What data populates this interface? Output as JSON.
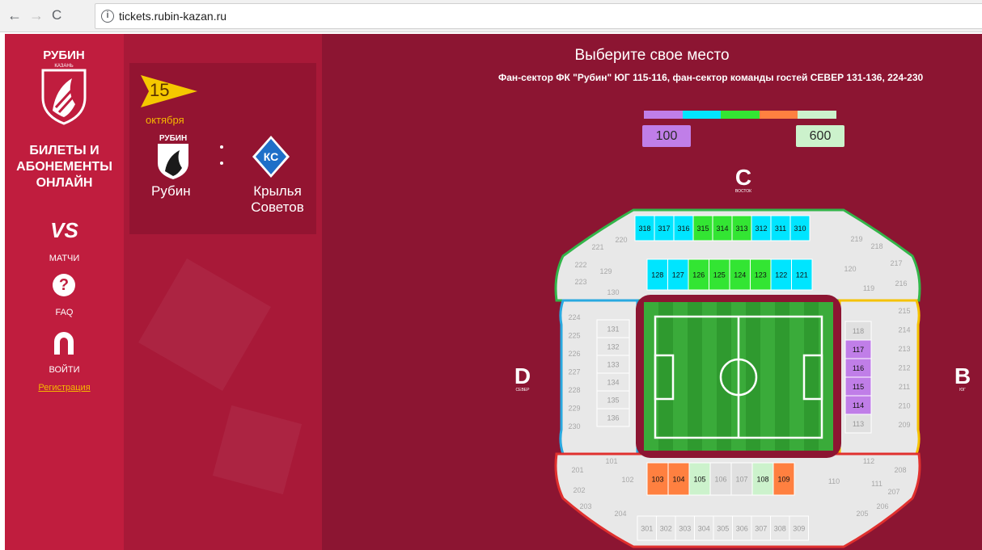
{
  "browser": {
    "url": "tickets.rubin-kazan.ru",
    "back_icon": "←",
    "forward_icon": "→",
    "reload_icon": "C",
    "info_icon": "i"
  },
  "sidebar": {
    "logo_text": "РУБИН",
    "logo_sub": "КАЗАНЬ",
    "title": "БИЛЕТЫ И АБОНЕМЕНТЫ ОНЛАЙН",
    "vs": "VS",
    "matches_label": "МАТЧИ",
    "faq_icon": "?",
    "faq_label": "FAQ",
    "login_label": "ВОЙТИ",
    "register_label": "Регистрация"
  },
  "match": {
    "day": "15",
    "month": "октября",
    "home_logo_text": "РУБИН",
    "home_team": "Рубин",
    "away_team_line1": "Крылья",
    "away_team_line2": "Советов",
    "away_logo_text": "КС"
  },
  "main": {
    "title": "Выберите свое место",
    "subtitle": "Фан-сектор ФК \"Рубин\" ЮГ 115-116, фан-сектор команды гостей СЕВЕР 131-136, 224-230",
    "price_min": "100",
    "price_max": "600",
    "legend_colors": [
      "#c07ee8",
      "#00e5ff",
      "#33e533",
      "#ff8040",
      "#ccf2cc"
    ]
  },
  "directions": {
    "north_letter": "D",
    "north_label": "СЕВЕР",
    "south_letter": "B",
    "south_label": "ЮГ",
    "east_letter": "C",
    "east_label": "ВОСТОК"
  },
  "sectors": {
    "top_upper": [
      {
        "n": "318",
        "c": "#00e5ff"
      },
      {
        "n": "317",
        "c": "#00e5ff"
      },
      {
        "n": "316",
        "c": "#00e5ff"
      },
      {
        "n": "315",
        "c": "#33e533"
      },
      {
        "n": "314",
        "c": "#33e533"
      },
      {
        "n": "313",
        "c": "#33e533"
      },
      {
        "n": "312",
        "c": "#00e5ff"
      },
      {
        "n": "311",
        "c": "#00e5ff"
      },
      {
        "n": "310",
        "c": "#00e5ff"
      }
    ],
    "top_lower": [
      {
        "n": "128",
        "c": "#00e5ff"
      },
      {
        "n": "127",
        "c": "#00e5ff"
      },
      {
        "n": "126",
        "c": "#33e533"
      },
      {
        "n": "125",
        "c": "#33e533"
      },
      {
        "n": "124",
        "c": "#33e533"
      },
      {
        "n": "123",
        "c": "#33e533"
      },
      {
        "n": "122",
        "c": "#00e5ff"
      },
      {
        "n": "121",
        "c": "#00e5ff"
      }
    ],
    "bottom_lower": [
      {
        "n": "103",
        "c": "#ff8040"
      },
      {
        "n": "104",
        "c": "#ff8040"
      },
      {
        "n": "105",
        "c": "#ccf2cc"
      },
      {
        "n": "106",
        "c": "#e0e0e0"
      },
      {
        "n": "107",
        "c": "#e0e0e0"
      },
      {
        "n": "108",
        "c": "#ccf2cc"
      },
      {
        "n": "109",
        "c": "#ff8040"
      }
    ],
    "bottom_upper": [
      "301",
      "302",
      "303",
      "304",
      "305",
      "306",
      "307",
      "308",
      "309"
    ],
    "left_inner": [
      "131",
      "132",
      "133",
      "134",
      "135",
      "136"
    ],
    "left_outer": [
      "224",
      "225",
      "226",
      "227",
      "228",
      "229",
      "230"
    ],
    "right_inner": [
      {
        "n": "118",
        "c": "#e0e0e0"
      },
      {
        "n": "117",
        "c": "#c07ee8"
      },
      {
        "n": "116",
        "c": "#c07ee8"
      },
      {
        "n": "115",
        "c": "#c07ee8"
      },
      {
        "n": "114",
        "c": "#c07ee8"
      },
      {
        "n": "113",
        "c": "#e0e0e0"
      }
    ],
    "right_outer": [
      "215",
      "214",
      "213",
      "212",
      "211",
      "210",
      "209"
    ],
    "corners": {
      "tl": [
        "221",
        "220",
        "222",
        "129",
        "223",
        "130"
      ],
      "tr": [
        "219",
        "218",
        "120",
        "217",
        "119",
        "216"
      ],
      "bl": [
        "101",
        "201",
        "102",
        "202",
        "203",
        "204"
      ],
      "br": [
        "112",
        "208",
        "111",
        "110",
        "207",
        "206",
        "205"
      ]
    }
  }
}
